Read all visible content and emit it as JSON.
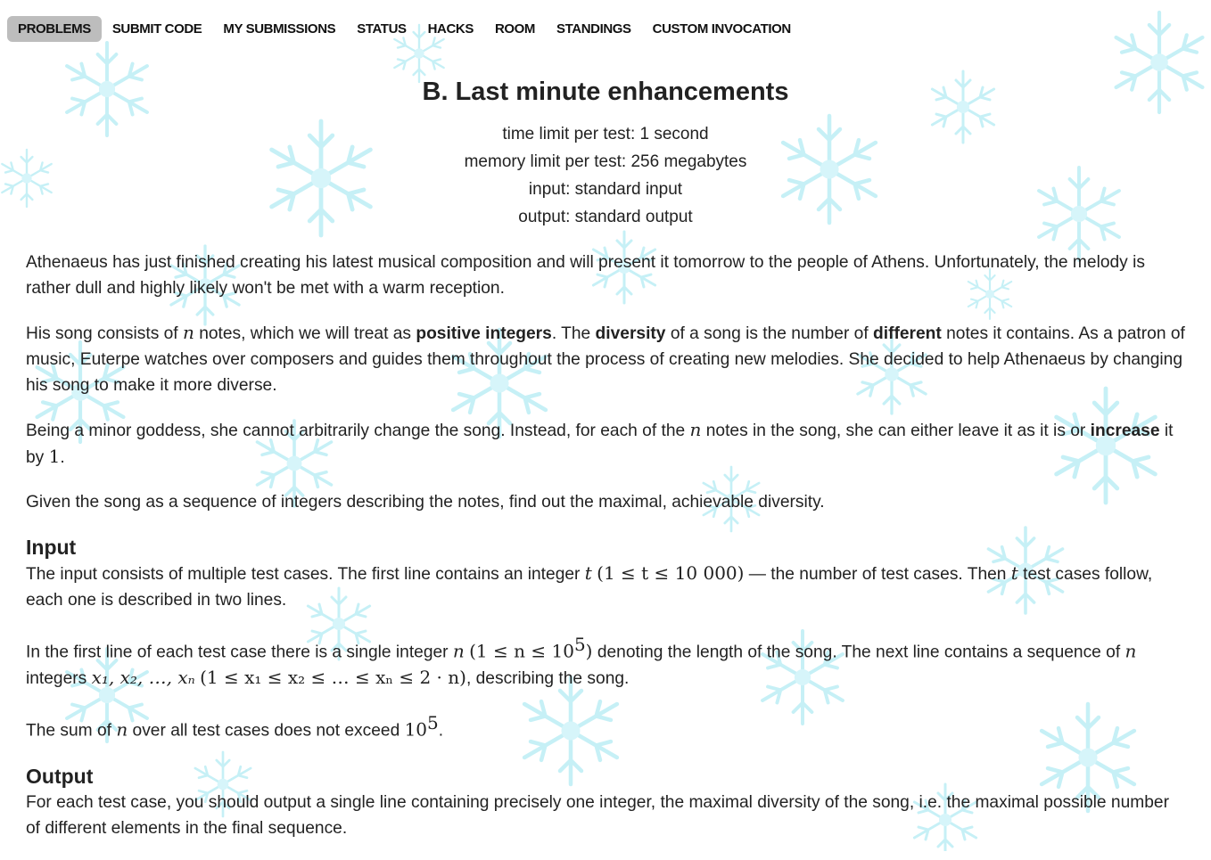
{
  "nav": {
    "items": [
      {
        "label": "PROBLEMS",
        "active": true
      },
      {
        "label": "SUBMIT CODE"
      },
      {
        "label": "MY SUBMISSIONS"
      },
      {
        "label": "STATUS"
      },
      {
        "label": "HACKS"
      },
      {
        "label": "ROOM"
      },
      {
        "label": "STANDINGS"
      },
      {
        "label": "CUSTOM INVOCATION"
      }
    ]
  },
  "problem": {
    "title": "B. Last minute enhancements",
    "time_limit": "time limit per test: 1 second",
    "memory_limit": "memory limit per test: 256 megabytes",
    "input_file": "input: standard input",
    "output_file": "output: standard output"
  },
  "legend": {
    "p1": "Athenaeus has just finished creating his latest musical composition and will present it tomorrow to the people of Athens. Unfortunately, the melody is rather dull and highly likely won't be met with a warm reception.",
    "p2_a": "His song consists of ",
    "p2_n": "n",
    "p2_b": " notes, which we will treat as ",
    "p2_bold1": "positive integers",
    "p2_c": ". The ",
    "p2_bold2": "diversity",
    "p2_d": " of a song is the number of ",
    "p2_bold3": "different",
    "p2_e": " notes it contains. As a patron of music, Euterpe watches over composers and guides them throughout the process of creating new melodies. She decided to help Athenaeus by changing his song to make it more diverse.",
    "p3_a": "Being a minor goddess, she cannot arbitrarily change the song. Instead, for each of the ",
    "p3_n": "n",
    "p3_b": " notes in the song, she can either leave it as it is or ",
    "p3_bold": "increase",
    "p3_c": " it by ",
    "p3_one": "1",
    "p3_d": ".",
    "p4": "Given the song as a sequence of integers describing the notes, find out the maximal, achievable diversity."
  },
  "input_spec": {
    "heading": "Input",
    "p1_a": "The input consists of multiple test cases. The first line contains an integer ",
    "p1_t": "t",
    "p1_cons": "(1 ≤ t ≤ 10 000)",
    "p1_b": " — the number of test cases. Then ",
    "p1_t2": "t",
    "p1_c": " test cases follow, each one is described in two lines.",
    "p2_a": "In the first line of each test case there is a single integer ",
    "p2_n": "n",
    "p2_cons": "(1 ≤ n ≤ 10",
    "p2_exp": "5",
    "p2_close": ")",
    "p2_b": " denoting the length of the song. The next line contains a sequence of ",
    "p2_n2": "n",
    "p2_c": " integers ",
    "p2_seq": "x₁, x₂, …, xₙ",
    "p2_cons2": "(1 ≤ x₁ ≤ x₂ ≤ … ≤ xₙ ≤ 2 · n)",
    "p2_d": ", describing the song.",
    "p3_a": "The sum of ",
    "p3_n": "n",
    "p3_b": " over all test cases does not exceed ",
    "p3_val": "10",
    "p3_exp": "5",
    "p3_c": "."
  },
  "output_spec": {
    "heading": "Output",
    "p1": "For each test case, you should output a single line containing precisely one integer, the maximal diversity of the song, i.e. the maximal possible number of different elements in the final sequence."
  },
  "colors": {
    "snowflake": "#c8f1f7",
    "active_tab": "#bdbdbd",
    "text": "#222222"
  }
}
